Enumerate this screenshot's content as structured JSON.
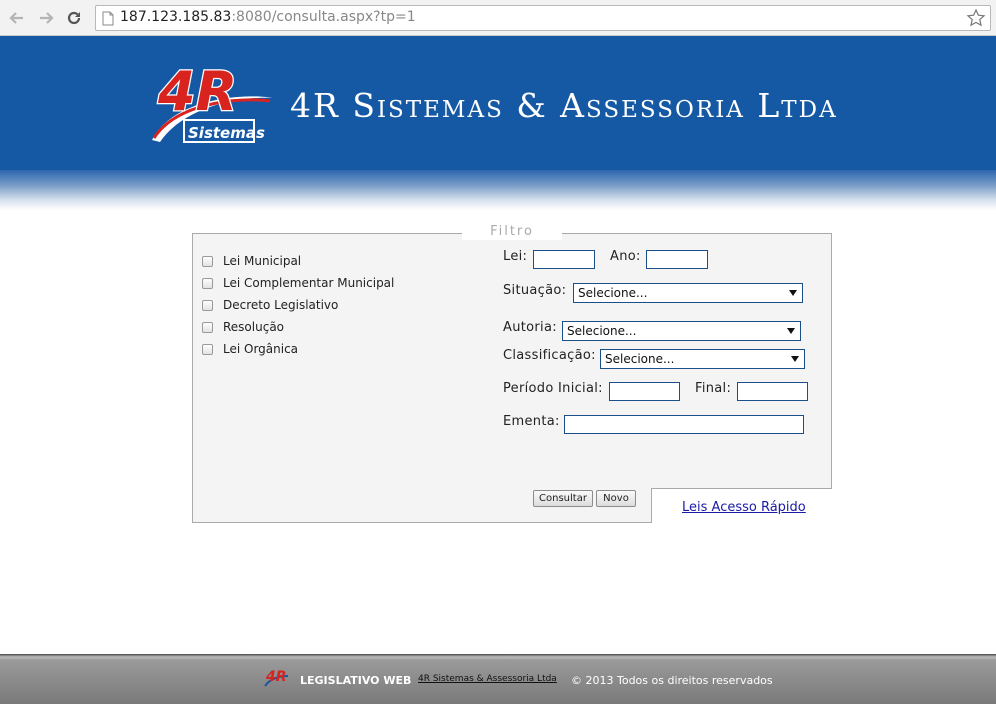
{
  "browser": {
    "url_host": "187.123.185.83",
    "url_rest": ":8080/consulta.aspx?tp=1"
  },
  "banner": {
    "logo_text": "4R",
    "logo_subtext": "Sistemas",
    "title": "4R Sistemas & Assessoria Ltda"
  },
  "filter": {
    "legend": "Filtro",
    "types": [
      {
        "label": "Lei Municipal",
        "checked": false
      },
      {
        "label": "Lei Complementar Municipal",
        "checked": false
      },
      {
        "label": "Decreto Legislativo",
        "checked": false
      },
      {
        "label": "Resolução",
        "checked": false
      },
      {
        "label": "Lei Orgânica",
        "checked": false
      }
    ],
    "lei_label": "Lei:",
    "lei_value": "",
    "ano_label": "Ano:",
    "ano_value": "",
    "situacao_label": "Situação:",
    "situacao_value": "Selecione...",
    "autoria_label": "Autoria:",
    "autoria_value": "Selecione...",
    "classificacao_label": "Classificação:",
    "classificacao_value": "Selecione...",
    "periodo_inicial_label": "Período Inicial:",
    "periodo_inicial_value": "",
    "final_label": "Final:",
    "final_value": "",
    "ementa_label": "Ementa:",
    "ementa_value": "",
    "consultar_label": "Consultar",
    "novo_label": "Novo",
    "quick_link": "Leis Acesso Rápido"
  },
  "footer": {
    "logo_text": "4R",
    "app_name": "LEGISLATIVO WEB",
    "company": "4R Sistemas & Assessoria Ltda",
    "copyright": "© 2013 Todos os direitos reservados"
  },
  "colors": {
    "banner": "#1559a5",
    "logo_red": "#d8231f",
    "link": "#1a1aa6"
  }
}
